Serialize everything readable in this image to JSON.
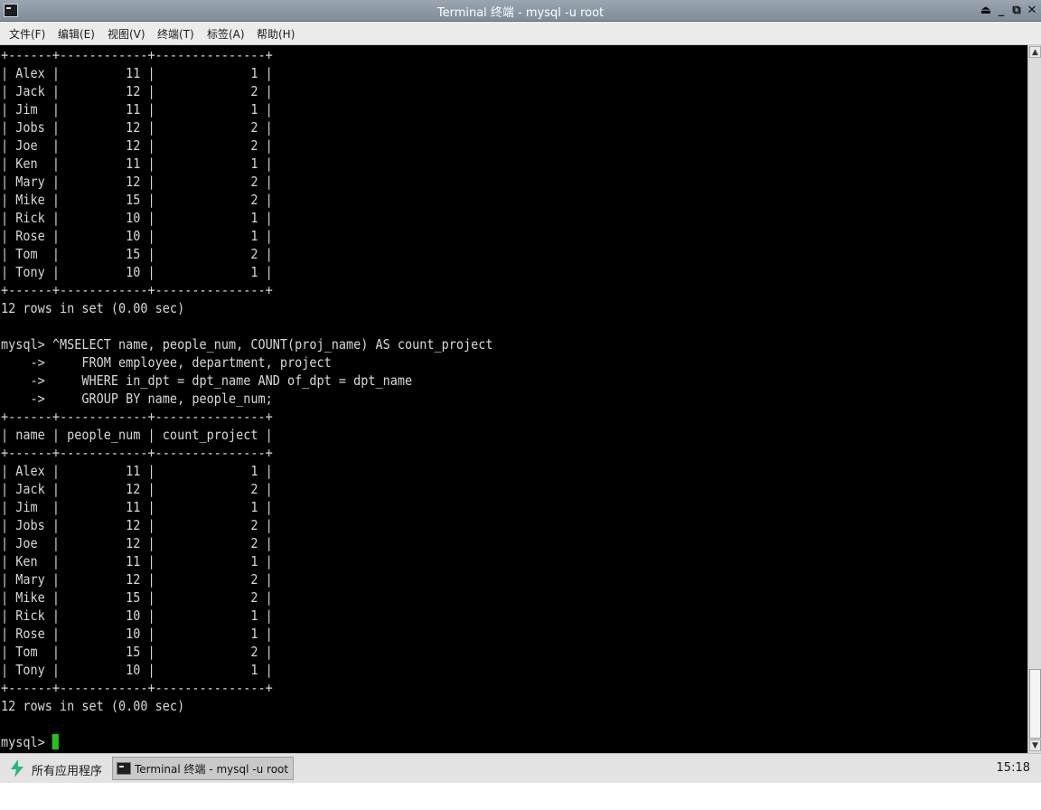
{
  "window": {
    "title": "Terminal 终端 - mysql -u root",
    "icon": "terminal-icon",
    "controls": [
      "eject-icon",
      "minimize-icon",
      "restore-icon",
      "close-icon"
    ],
    "control_glyphs": {
      "eject": "⏏",
      "minimize": "_",
      "restore": "⧉",
      "close": "✕"
    }
  },
  "menubar": {
    "items": [
      "文件(F)",
      "编辑(E)",
      "视图(V)",
      "终端(T)",
      "标签(A)",
      "帮助(H)"
    ]
  },
  "terminal": {
    "colors": {
      "background": "#000000",
      "foreground": "#d8d8d8",
      "cursor": "#22c31a"
    },
    "lines": [
      "+------+------------+---------------+",
      "| Alex |         11 |             1 |",
      "| Jack |         12 |             2 |",
      "| Jim  |         11 |             1 |",
      "| Jobs |         12 |             2 |",
      "| Joe  |         12 |             2 |",
      "| Ken  |         11 |             1 |",
      "| Mary |         12 |             2 |",
      "| Mike |         15 |             2 |",
      "| Rick |         10 |             1 |",
      "| Rose |         10 |             1 |",
      "| Tom  |         15 |             2 |",
      "| Tony |         10 |             1 |",
      "+------+------------+---------------+",
      "12 rows in set (0.00 sec)",
      "",
      "mysql> ^MSELECT name, people_num, COUNT(proj_name) AS count_project",
      "    ->     FROM employee, department, project",
      "    ->     WHERE in_dpt = dpt_name AND of_dpt = dpt_name",
      "    ->     GROUP BY name, people_num;",
      "+------+------------+---------------+",
      "| name | people_num | count_project |",
      "+------+------------+---------------+",
      "| Alex |         11 |             1 |",
      "| Jack |         12 |             2 |",
      "| Jim  |         11 |             1 |",
      "| Jobs |         12 |             2 |",
      "| Joe  |         12 |             2 |",
      "| Ken  |         11 |             1 |",
      "| Mary |         12 |             2 |",
      "| Mike |         15 |             2 |",
      "| Rick |         10 |             1 |",
      "| Rose |         10 |             1 |",
      "| Tom  |         15 |             2 |",
      "| Tony |         10 |             1 |",
      "+------+------------+---------------+",
      "12 rows in set (0.00 sec)",
      ""
    ],
    "prompt": "mysql> "
  },
  "scrollbar": {
    "up_icon": "▲",
    "down_icon": "▼",
    "position": "bottom"
  },
  "taskbar": {
    "start_label": "所有应用程序",
    "start_icon": "app-launcher-icon",
    "task_label": "Terminal 终端 - mysql -u root",
    "clock": "15:18"
  }
}
